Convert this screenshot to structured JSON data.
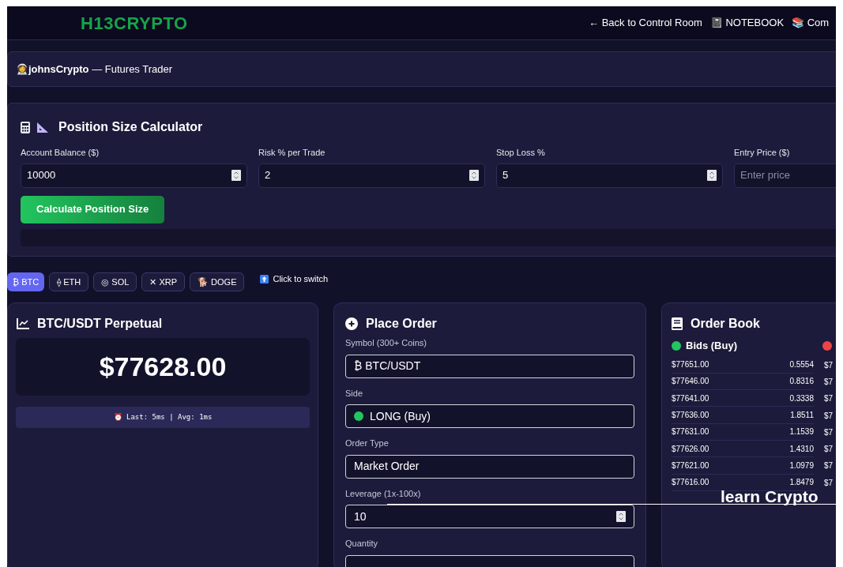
{
  "header": {
    "logo": "H13CRYPTO",
    "nav": [
      {
        "icon": "←",
        "label": "Back to Control Room"
      },
      {
        "icon": "📓",
        "label": "NOTEBOOK"
      },
      {
        "icon": "📚",
        "label": "Com"
      }
    ]
  },
  "user_bar": {
    "icon": "👩‍🚀",
    "name": "johnsCrypto",
    "role": "— Futures Trader"
  },
  "calculator": {
    "title": "Position Size Calculator",
    "fields": [
      {
        "label": "Account Balance ($)",
        "value": "10000"
      },
      {
        "label": "Risk % per Trade",
        "value": "2"
      },
      {
        "label": "Stop Loss %",
        "value": "5"
      },
      {
        "label": "Entry Price ($)",
        "placeholder": "Enter price"
      }
    ],
    "button": "Calculate Position Size"
  },
  "coins": [
    {
      "label": "₿ BTC",
      "selected": true
    },
    {
      "label": "⟠ ETH",
      "selected": false
    },
    {
      "label": "◎ SOL",
      "selected": false
    },
    {
      "label": "✕ XRP",
      "selected": false
    },
    {
      "label": "🐕 DOGE",
      "selected": false
    }
  ],
  "switch_hint": "Click to switch",
  "ticker": {
    "title": "BTC/USDT Perpetual",
    "price": "$77628.00",
    "latency": "⏰ Last: 5ms | Avg: 1ms"
  },
  "order": {
    "title": "Place Order",
    "fields": [
      {
        "kind": "text",
        "label": "Symbol (300+ Coins)",
        "value": "₿ BTC/USDT"
      },
      {
        "kind": "select",
        "label": "Side",
        "value": "LONG (Buy)",
        "color": "#22c55e"
      },
      {
        "kind": "select",
        "label": "Order Type",
        "value": "Market Order"
      },
      {
        "kind": "number",
        "label": "Leverage (1x-100x)",
        "value": "10"
      },
      {
        "kind": "number",
        "label": "Quantity"
      }
    ]
  },
  "order_book": {
    "title": "Order Book",
    "sides": [
      {
        "title": "Bids (Buy)",
        "color": "#22c55e"
      },
      {
        "color": "#ef4444"
      }
    ],
    "rows": [
      {
        "price": "$77651.00",
        "size": "0.5554",
        "ask": "$7"
      },
      {
        "price": "$77646.00",
        "size": "0.8316",
        "ask": "$7"
      },
      {
        "price": "$77641.00",
        "size": "0.3338",
        "ask": "$7"
      },
      {
        "price": "$77636.00",
        "size": "1.8511",
        "ask": "$7"
      },
      {
        "price": "$77631.00",
        "size": "1.1539",
        "ask": "$7"
      },
      {
        "price": "$77626.00",
        "size": "1.4310",
        "ask": "$7"
      },
      {
        "price": "$77621.00",
        "size": "1.0979",
        "ask": "$7"
      },
      {
        "price": "$77616.00",
        "size": "1.8479",
        "ask": "$7"
      }
    ]
  },
  "annotation": "learn Crypto"
}
